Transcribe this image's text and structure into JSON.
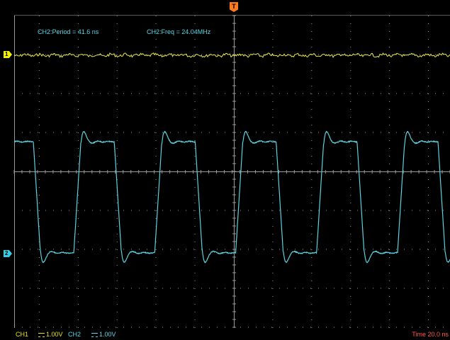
{
  "measurements": {
    "period": "CH2:Period = 41.6 ns",
    "frequency": "CH2:Freq = 24.04MHz"
  },
  "markers": {
    "ch1": "1",
    "ch2": "2",
    "trigger": "T"
  },
  "status_bar": {
    "ch1_label": "CH1",
    "ch1_scale": "1.00V",
    "ch2_label": "CH2",
    "ch2_scale": "1.00V",
    "time_base": "Time 20.0 ns"
  },
  "colors": {
    "background": "#000000",
    "grid": "#9a9a9a",
    "ch1_trace": "#e8e84a",
    "ch2_trace": "#5ad2e0",
    "trigger_marker": "#ff7a1c",
    "time_base_text": "#ff5a3a"
  },
  "waveforms": {
    "ch2_period_ns": 41.6,
    "ch2_frequency_mhz": 24.04,
    "ch1_volts_per_div": 1.0,
    "ch2_volts_per_div": 1.0,
    "time_per_div_ns": 20.0
  }
}
